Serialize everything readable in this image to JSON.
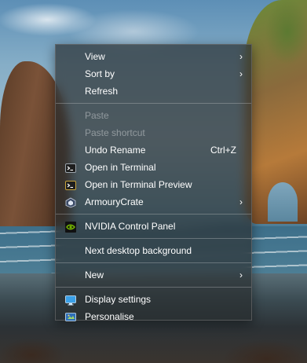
{
  "menu": {
    "items": [
      {
        "label": "View",
        "submenu": true
      },
      {
        "label": "Sort by",
        "submenu": true
      },
      {
        "label": "Refresh"
      },
      {
        "label": "Paste",
        "disabled": true
      },
      {
        "label": "Paste shortcut",
        "disabled": true
      },
      {
        "label": "Undo Rename",
        "shortcut": "Ctrl+Z"
      },
      {
        "label": "Open in Terminal",
        "icon": "terminal-icon"
      },
      {
        "label": "Open in Terminal Preview",
        "icon": "terminal-preview-icon"
      },
      {
        "label": "ArmouryCrate",
        "icon": "armourycrate-icon",
        "submenu": true
      },
      {
        "label": "NVIDIA Control Panel",
        "icon": "nvidia-icon"
      },
      {
        "label": "Next desktop background"
      },
      {
        "label": "New",
        "submenu": true
      },
      {
        "label": "Display settings",
        "icon": "display-icon"
      },
      {
        "label": "Personalise",
        "icon": "personalise-icon"
      }
    ],
    "arrow_glyph": "›"
  },
  "colors": {
    "menu_bg": "#2c3032",
    "nvidia_green": "#76b900",
    "display_blue": "#3aa0e8"
  }
}
